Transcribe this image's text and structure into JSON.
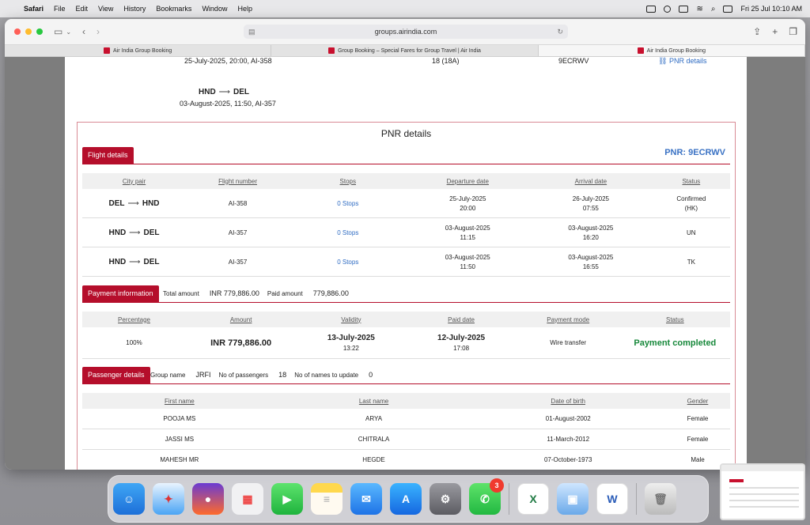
{
  "menubar": {
    "app": "Safari",
    "items": [
      "File",
      "Edit",
      "View",
      "History",
      "Bookmarks",
      "Window",
      "Help"
    ],
    "datetime": "Fri 25 Jul  10:10 AM"
  },
  "browser": {
    "url": "groups.airindia.com",
    "tabs": [
      {
        "title": "Air India Group Booking"
      },
      {
        "title": "Group Booking – Special Fares for Group Travel | Air India"
      },
      {
        "title": "Air India Group Booking"
      }
    ]
  },
  "prev": {
    "row1_date": "25-July-2025, 20:00, AI-358",
    "row1_pax": "18 (18A)",
    "row1_pnr": "9ECRWV",
    "row1_link": "PNR details",
    "row2_from": "HND",
    "row2_to": "DEL",
    "row2_date": "03-August-2025, 11:50, AI-357"
  },
  "pnr": {
    "title": "PNR details",
    "code": "PNR: 9ECRWV"
  },
  "flight": {
    "tag": "Flight details",
    "headers": [
      "City pair",
      "Flight number",
      "Stops",
      "Departure date",
      "Arrival date",
      "Status"
    ],
    "rows": [
      {
        "from": "DEL",
        "to": "HND",
        "flight": "AI-358",
        "stops": "0 Stops",
        "dep_date": "25-July-2025",
        "dep_time": "20:00",
        "arr_date": "26-July-2025",
        "arr_time": "07:55",
        "status1": "Confirmed",
        "status2": "(HK)"
      },
      {
        "from": "HND",
        "to": "DEL",
        "flight": "AI-357",
        "stops": "0 Stops",
        "dep_date": "03-August-2025",
        "dep_time": "11:15",
        "arr_date": "03-August-2025",
        "arr_time": "16:20",
        "status1": "UN",
        "status2": ""
      },
      {
        "from": "HND",
        "to": "DEL",
        "flight": "AI-357",
        "stops": "0 Stops",
        "dep_date": "03-August-2025",
        "dep_time": "11:50",
        "arr_date": "03-August-2025",
        "arr_time": "16:55",
        "status1": "TK",
        "status2": ""
      }
    ]
  },
  "payment": {
    "tag": "Payment information",
    "total_label": "Total amount",
    "total_value": "INR  779,886.00",
    "paid_label": "Paid amount",
    "paid_value": "779,886.00",
    "headers": [
      "Percentage",
      "Amount",
      "Validity",
      "Paid date",
      "Payment mode",
      "Status"
    ],
    "row": {
      "percentage": "100%",
      "amount": "INR 779,886.00",
      "validity_date": "13-July-2025",
      "validity_time": "13:22",
      "paid_date": "12-July-2025",
      "paid_time": "17:08",
      "mode": "Wire transfer",
      "status": "Payment completed"
    }
  },
  "passenger": {
    "tag": "Passenger details",
    "group_label": "Group name",
    "group_value": "JRFI",
    "count_label": "No of passengers",
    "count_value": "18",
    "update_label": "No of names to update",
    "update_value": "0",
    "headers": [
      "First name",
      "Last name",
      "Date of birth",
      "Gender"
    ],
    "rows": [
      {
        "first": "POOJA MS",
        "last": "ARYA",
        "dob": "01-August-2002",
        "gender": "Female"
      },
      {
        "first": "JASSI MS",
        "last": "CHITRALA",
        "dob": "11-March-2012",
        "gender": "Female"
      },
      {
        "first": "MAHESH MR",
        "last": "HEGDE",
        "dob": "07-October-1973",
        "gender": "Male"
      }
    ]
  },
  "dock": {
    "whatsapp_badge": "3",
    "apps": [
      "finder-icon",
      "safari-icon",
      "firefox-icon",
      "launchpad-icon",
      "facetime-icon",
      "notes-icon",
      "mail-icon",
      "app-store-icon",
      "system-settings-icon",
      "whatsapp-icon",
      "excel-icon",
      "preview-icon",
      "word-icon",
      "trash-icon"
    ]
  }
}
